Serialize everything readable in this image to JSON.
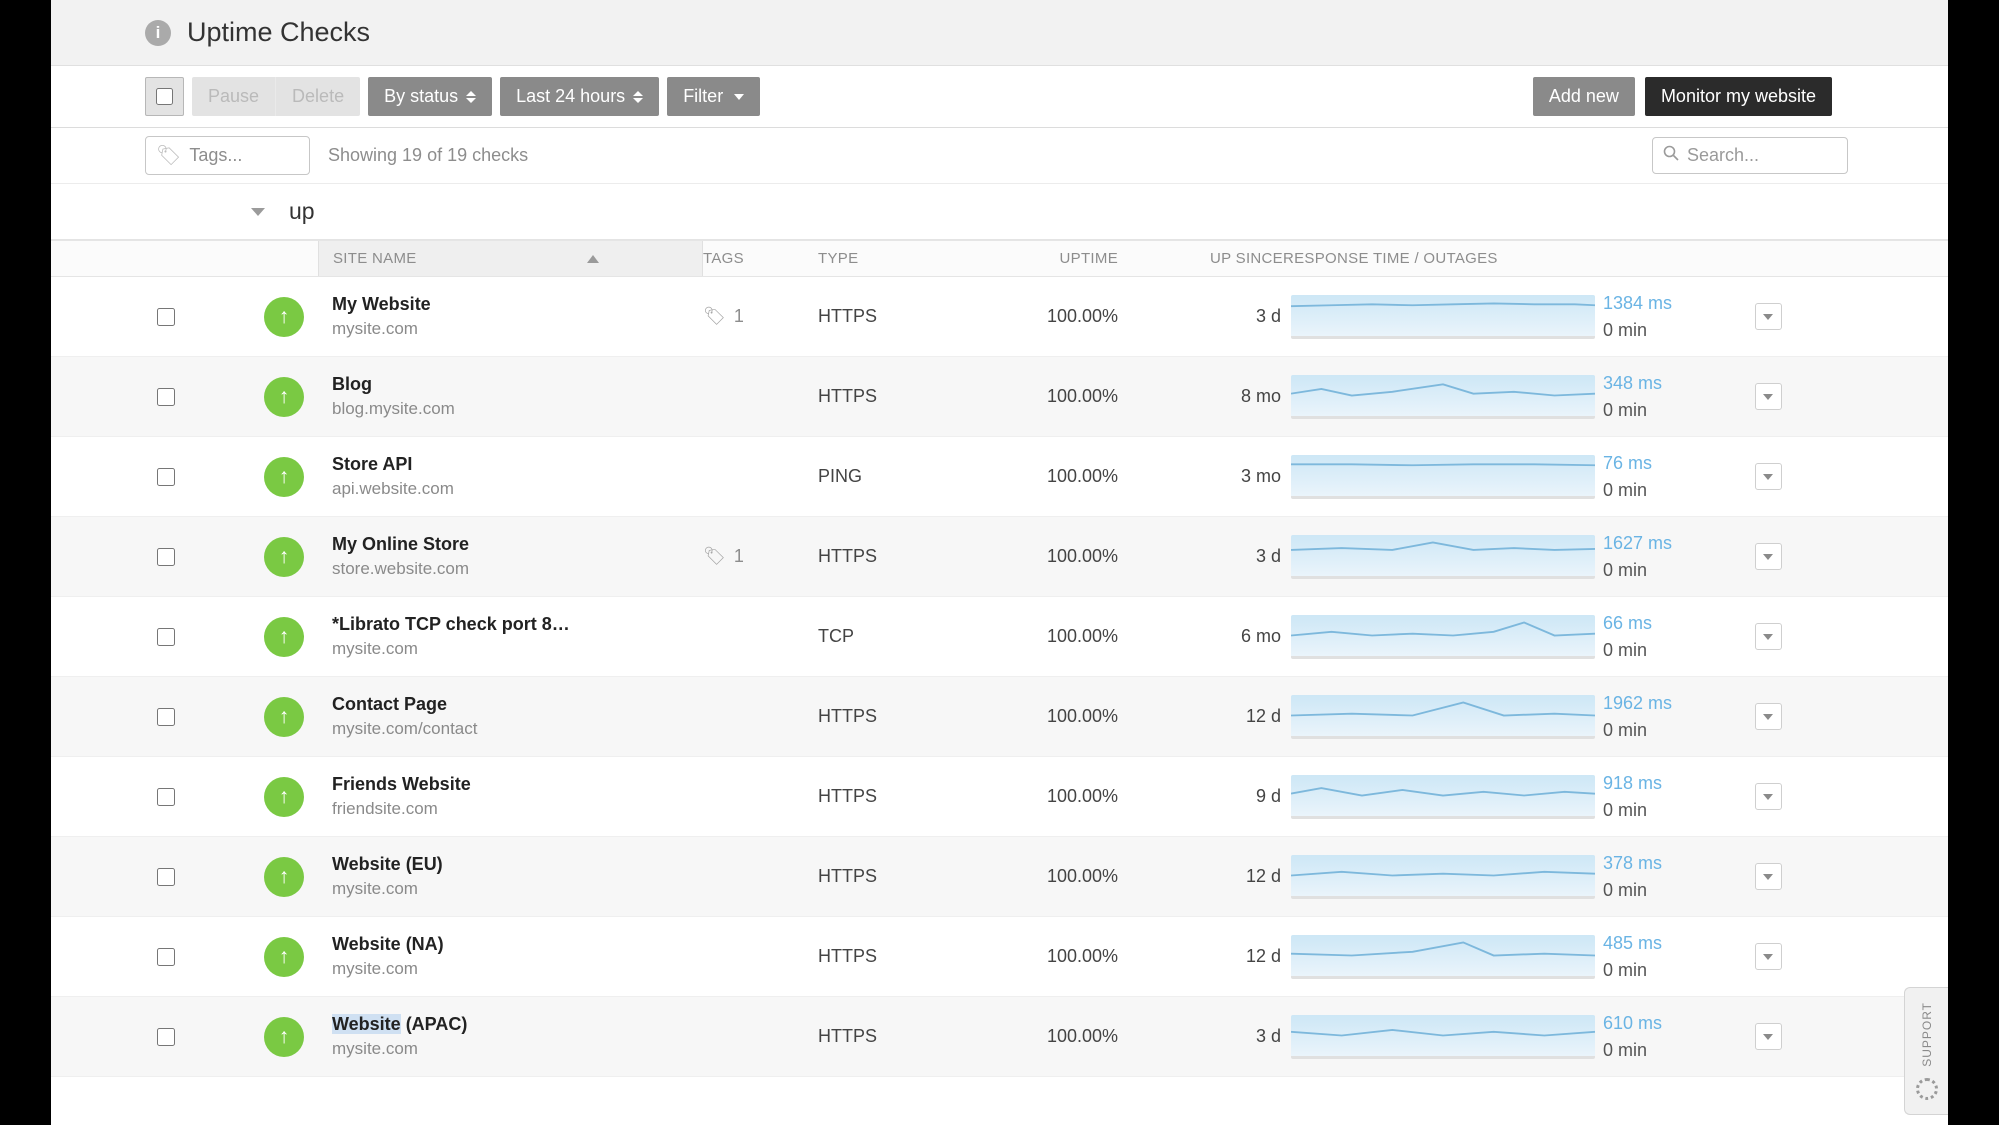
{
  "header": {
    "title": "Uptime Checks"
  },
  "toolbar": {
    "pause": "Pause",
    "delete": "Delete",
    "by_status": "By status",
    "last_24h": "Last 24 hours",
    "filter": "Filter",
    "add_new": "Add new",
    "monitor": "Monitor my website"
  },
  "filterbar": {
    "tags_placeholder": "Tags...",
    "showing": "Showing 19 of 19 checks",
    "search_placeholder": "Search..."
  },
  "group": {
    "label": "up"
  },
  "columns": {
    "site": "SITE NAME",
    "tags": "TAGS",
    "type": "TYPE",
    "uptime": "UPTIME",
    "since": "UP SINCE",
    "resp": "RESPONSE TIME / OUTAGES"
  },
  "rows": [
    {
      "name": "My Website",
      "url": "mysite.com",
      "tags": 1,
      "type": "HTTPS",
      "uptime": "100.00%",
      "since": "3 d",
      "rt": "1384 ms",
      "outage": "0 min"
    },
    {
      "name": "Blog",
      "url": "blog.mysite.com",
      "tags": null,
      "type": "HTTPS",
      "uptime": "100.00%",
      "since": "8 mo",
      "rt": "348 ms",
      "outage": "0 min"
    },
    {
      "name": "Store API",
      "url": "api.website.com",
      "tags": null,
      "type": "PING",
      "uptime": "100.00%",
      "since": "3 mo",
      "rt": "76 ms",
      "outage": "0 min"
    },
    {
      "name": "My Online Store",
      "url": "store.website.com",
      "tags": 1,
      "type": "HTTPS",
      "uptime": "100.00%",
      "since": "3 d",
      "rt": "1627 ms",
      "outage": "0 min"
    },
    {
      "name": "*Librato TCP check port 8…",
      "url": "mysite.com",
      "tags": null,
      "type": "TCP",
      "uptime": "100.00%",
      "since": "6 mo",
      "rt": "66 ms",
      "outage": "0 min"
    },
    {
      "name": "Contact Page",
      "url": "mysite.com/contact",
      "tags": null,
      "type": "HTTPS",
      "uptime": "100.00%",
      "since": "12 d",
      "rt": "1962 ms",
      "outage": "0 min"
    },
    {
      "name": "Friends Website",
      "url": "friendsite.com",
      "tags": null,
      "type": "HTTPS",
      "uptime": "100.00%",
      "since": "9 d",
      "rt": "918 ms",
      "outage": "0 min"
    },
    {
      "name": "Website (EU)",
      "url": "mysite.com",
      "tags": null,
      "type": "HTTPS",
      "uptime": "100.00%",
      "since": "12 d",
      "rt": "378 ms",
      "outage": "0 min"
    },
    {
      "name": "Website (NA)",
      "url": "mysite.com",
      "tags": null,
      "type": "HTTPS",
      "uptime": "100.00%",
      "since": "12 d",
      "rt": "485 ms",
      "outage": "0 min"
    },
    {
      "name": "Website (APAC)",
      "url": "mysite.com",
      "tags": null,
      "type": "HTTPS",
      "uptime": "100.00%",
      "since": "3 d",
      "rt": "610 ms",
      "outage": "0 min",
      "hlname": "Website"
    }
  ],
  "support": "SUPPORT"
}
